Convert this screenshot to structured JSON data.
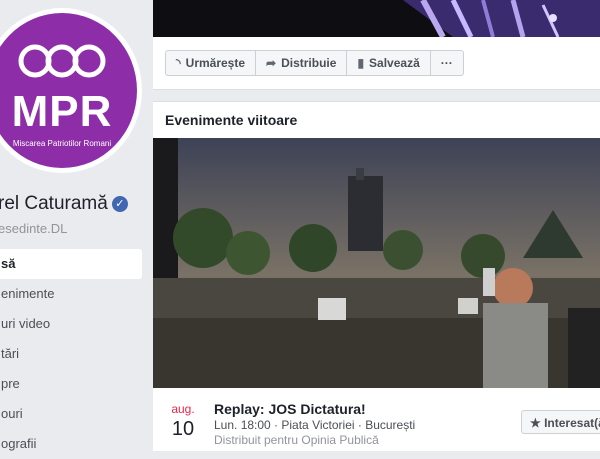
{
  "sidebar": {
    "logo": {
      "letters": "MPR",
      "subtitle": "Miscarea Patriotilor Romani",
      "color": "#8e2da8"
    },
    "page_name": "rel Caturamă",
    "username": "esedinte.DL",
    "nav": [
      "să",
      "enimente",
      "uri video",
      "tări",
      "pre",
      "ouri",
      "ografii"
    ],
    "active_index": 0
  },
  "actions": {
    "follow": {
      "label": "Urmărește",
      "icon": "rss-icon"
    },
    "share": {
      "label": "Distribuie",
      "icon": "share-arrow-icon"
    },
    "save": {
      "label": "Salvează",
      "icon": "bookmark-icon"
    },
    "more": {
      "label": "···",
      "icon": "more-icon"
    }
  },
  "events": {
    "title": "Evenimente viitoare",
    "items": [
      {
        "month": "aug.",
        "day": "10",
        "title": "Replay: JOS Dictatura!",
        "meta": "Lun. 18:00 · Piata Victoriei · București",
        "host": "Distribuit pentru Opinia Publică",
        "interested_label": "★ Interesat(ă)"
      }
    ]
  }
}
